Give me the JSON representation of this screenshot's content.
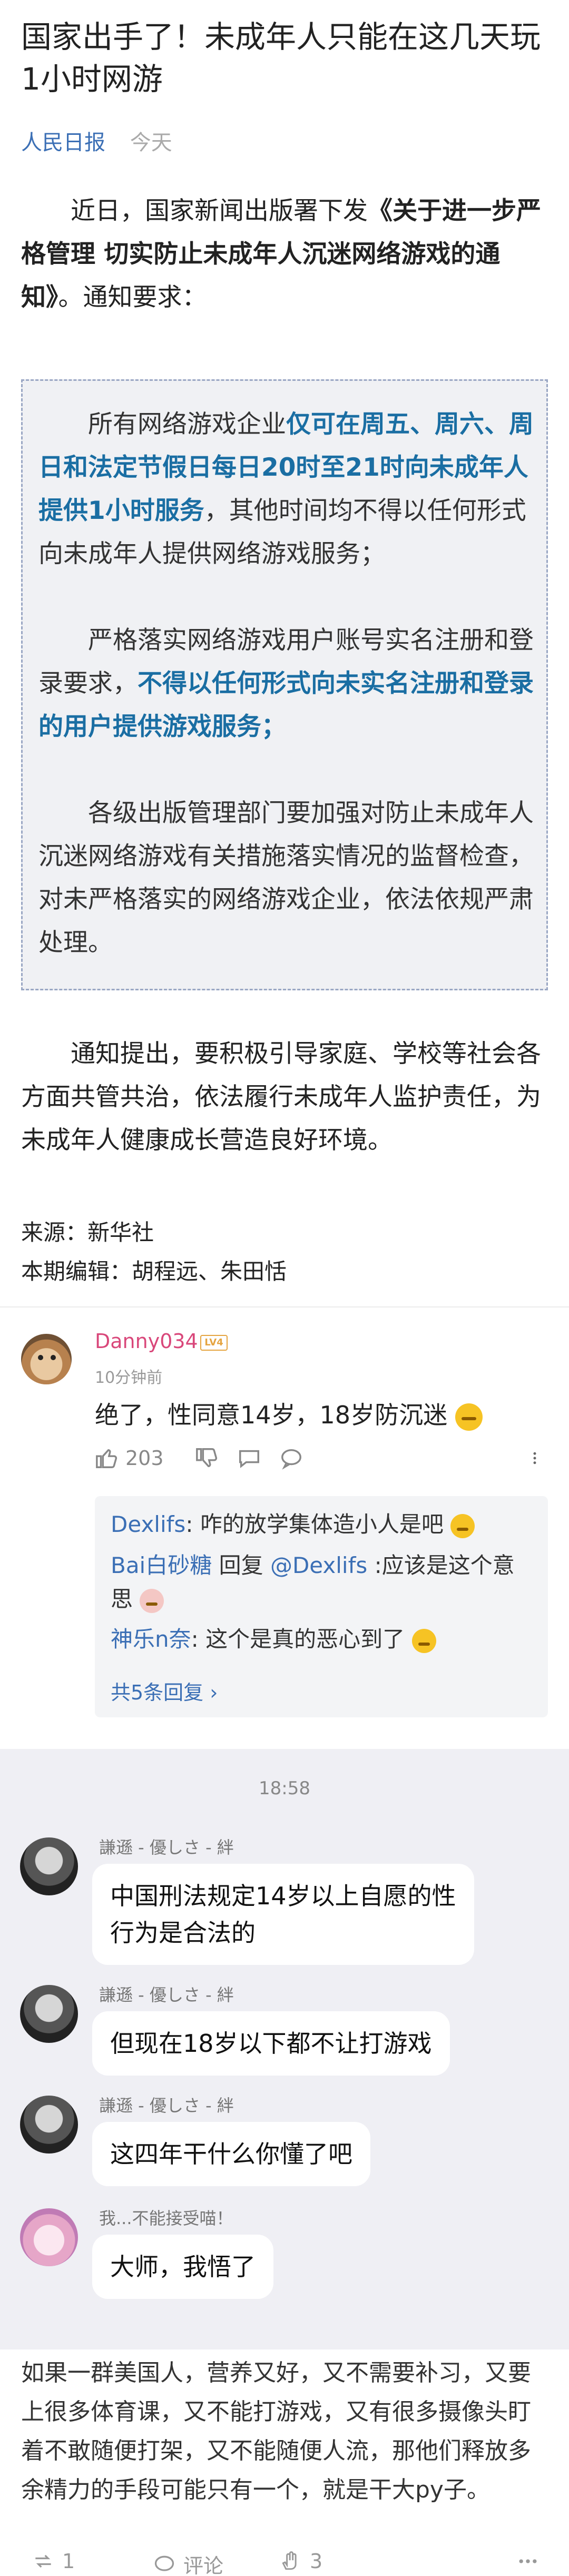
{
  "article": {
    "title": "国家出手了！未成年人只能在这几天玩1小时网游",
    "source": "人民日报",
    "date": "今天",
    "intro": {
      "prefix": "近日，国家新闻出版署下发",
      "bold": "《关于进一步严格管理 切实防止未成年人沉迷网络游戏的通知》",
      "suffix": "。通知要求："
    },
    "notice": {
      "p1_prefix": "所有网络游戏企业",
      "p1_blue": "仅可在周五、周六、周日和法定节假日每日20时至21时向未成年人提供1小时服务",
      "p1_suffix": "，其他时间均不得以任何形式向未成年人提供网络游戏服务；",
      "p2_prefix": "严格落实网络游戏用户账号实名注册和登录要求，",
      "p2_blue": "不得以任何形式向未实名注册和登录的用户提供游戏服务；",
      "p3": "各级出版管理部门要加强对防止未成年人沉迷网络游戏有关措施落实情况的监督检查，对未严格落实的网络游戏企业，依法依规严肃处理。"
    },
    "outro": "通知提出，要积极引导家庭、学校等社会各方面共管共治，依法履行未成年人监护责任，为未成年人健康成长营造良好环境。",
    "credit_source": "来源：新华社",
    "credit_editors": "本期编辑：胡程远、朱田恬"
  },
  "comment": {
    "username": "Danny034",
    "level": "LV4",
    "time": "10分钟前",
    "text": "绝了，性同意14岁，18岁防沉迷",
    "likes": "203",
    "replies": [
      {
        "name": "Dexlifs",
        "text": ": 咋的放学集体造小人是吧"
      },
      {
        "name": "Bai白砂糖",
        "mid": " 回复 ",
        "target": "@Dexlifs",
        "text": " :应该是这个意思"
      },
      {
        "name": "神乐n奈",
        "text": ": 这个是真的恶心到了"
      }
    ],
    "more_replies": "共5条回复 ›"
  },
  "chat": {
    "time": "18:58",
    "messages": [
      {
        "sender": "謙遜 - 優しさ - 絆",
        "text_lines": [
          "中国刑法规定14岁以上自愿的性",
          "行为是合法的"
        ]
      },
      {
        "sender": "謙遜 - 優しさ - 絆",
        "text_lines": [
          "但现在18岁以下都不让打游戏"
        ]
      },
      {
        "sender": "謙遜 - 優しさ - 絆",
        "text_lines": [
          "这四年干什么你懂了吧"
        ]
      },
      {
        "sender": "我...不能接受喵！",
        "text_lines": [
          "大师，我悟了"
        ]
      }
    ]
  },
  "post": {
    "text": "如果一群美国人，营养又好，又不需要补习，又要上很多体育课，又不能打游戏，又有很多摄像头盯着不敢随便打架，又不能随便人流，那他们释放多余精力的手段可能只有一个，就是干大py子。",
    "repost_count": "1",
    "comment_label": "评论",
    "like_count": "3"
  },
  "icons": [
    "thumbs-up-icon",
    "thumbs-down-icon",
    "chat-bubble-icon",
    "comment-icon",
    "more-icon",
    "repost-icon",
    "clap-icon"
  ]
}
